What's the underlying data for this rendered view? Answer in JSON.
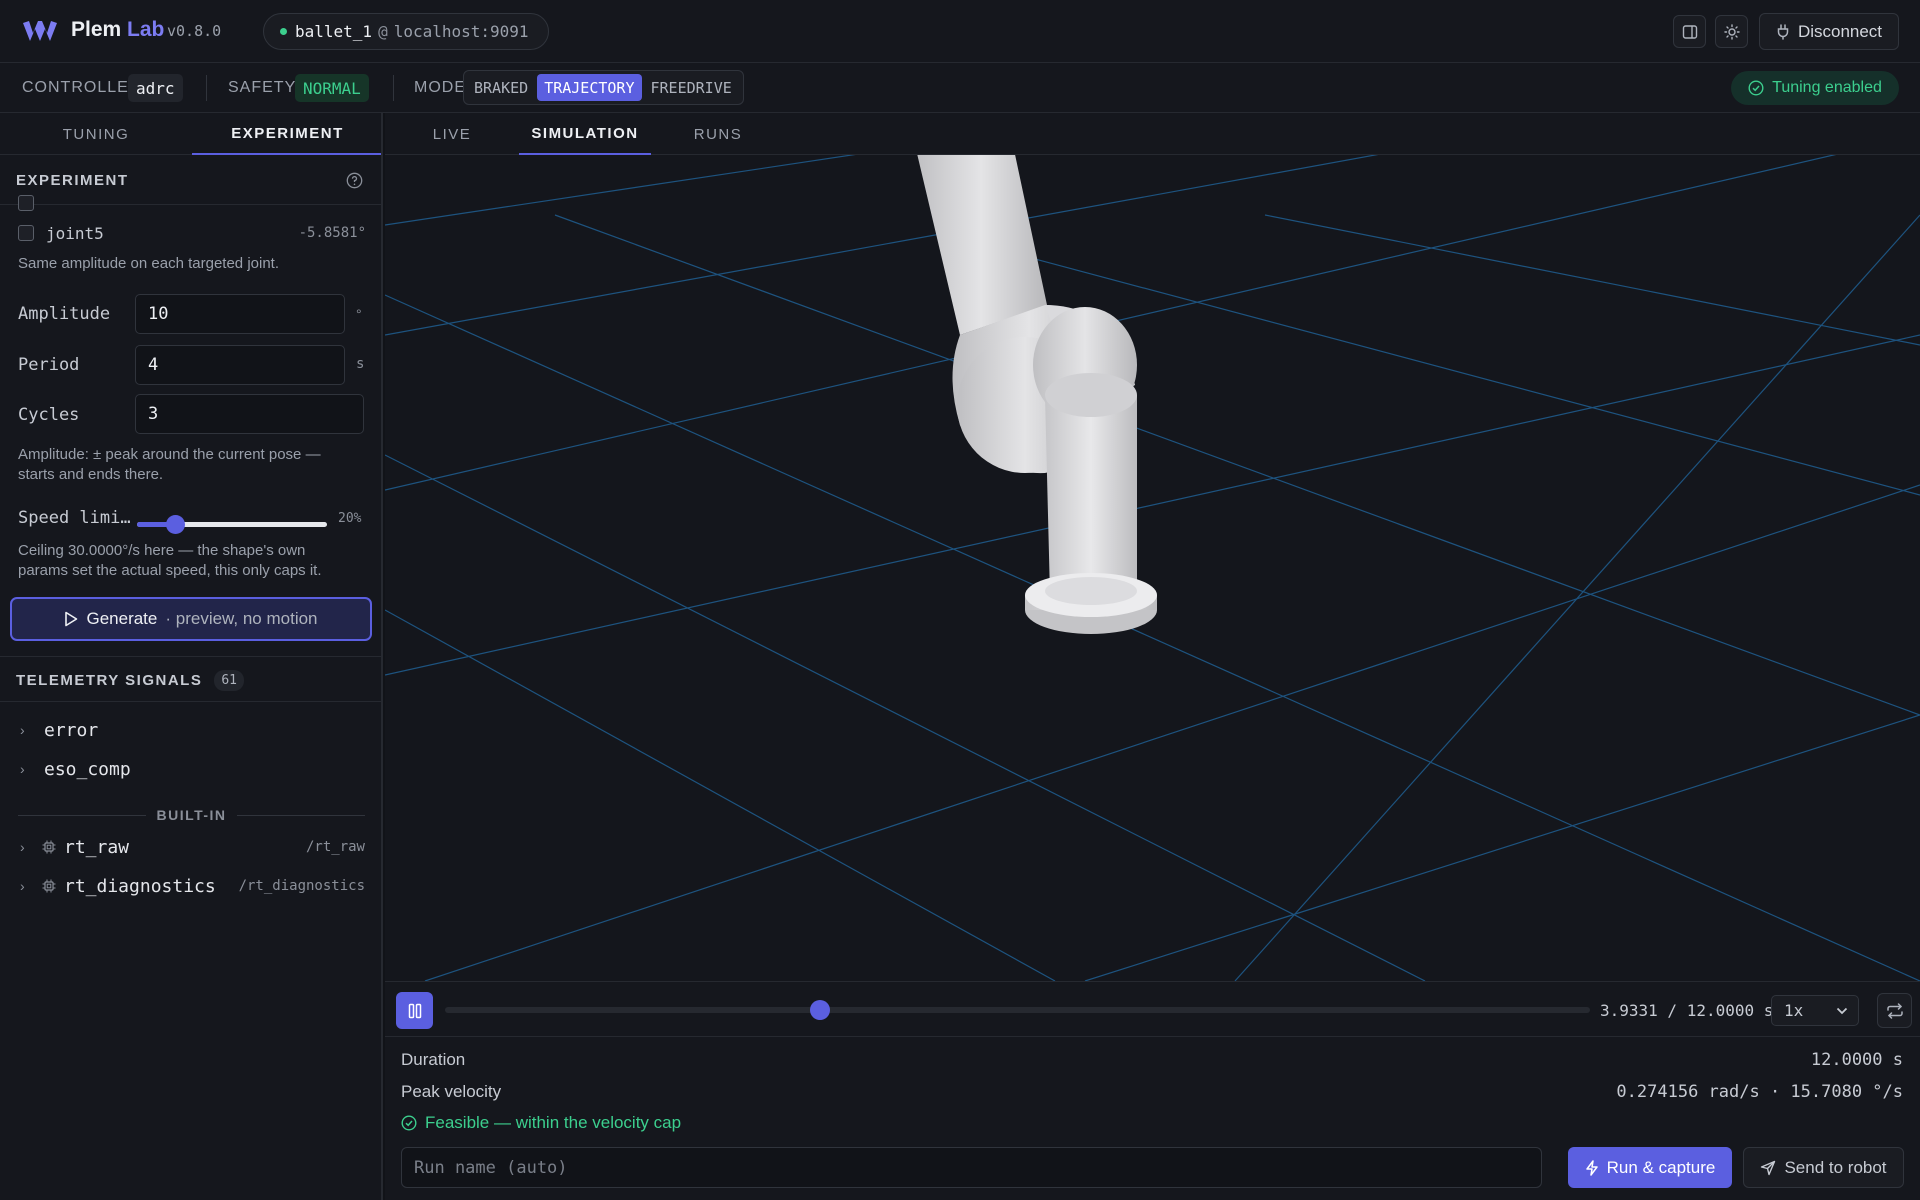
{
  "app": {
    "name_primary": "Plem",
    "name_accent": "Lab",
    "version": "v0.8.0",
    "connection": {
      "name": "ballet_1",
      "at": "@",
      "host": "localhost:9091"
    },
    "disconnect_label": "Disconnect"
  },
  "status_bar": {
    "controller_label": "CONTROLLER",
    "controller_value": "adrc",
    "safety_label": "SAFETY",
    "safety_value": "NORMAL",
    "mode_label": "MODE",
    "modes": [
      {
        "label": "BRAKED",
        "active": false
      },
      {
        "label": "TRAJECTORY",
        "active": true
      },
      {
        "label": "FREEDRIVE",
        "active": false
      }
    ],
    "tuning_badge": "Tuning enabled"
  },
  "left_panel": {
    "tabs": [
      {
        "label": "TUNING",
        "active": false
      },
      {
        "label": "EXPERIMENT",
        "active": true
      }
    ],
    "section_title": "EXPERIMENT",
    "joints": [
      {
        "name": "joint5",
        "value": "-5.8581°",
        "checked": false
      }
    ],
    "amplitude_note": "Same amplitude on each targeted joint.",
    "fields": {
      "amplitude": {
        "label": "Amplitude",
        "value": "10",
        "unit": "°"
      },
      "period": {
        "label": "Period",
        "value": "4",
        "unit": "s"
      },
      "cycles": {
        "label": "Cycles",
        "value": "3"
      }
    },
    "amplitude_help": "Amplitude: ± peak around the current pose — starts and ends there.",
    "speed_limit": {
      "label": "Speed limi…",
      "percent": 20,
      "display": "20%"
    },
    "speed_help": "Ceiling 30.0000°/s here — the shape's own params set the actual speed, this only caps it.",
    "generate": {
      "label": "Generate",
      "sub": "· preview, no motion"
    },
    "telemetry": {
      "title": "TELEMETRY SIGNALS",
      "count": "61",
      "custom": [
        {
          "name": "error"
        },
        {
          "name": "eso_comp"
        }
      ],
      "builtin_label": "BUILT-IN",
      "builtin": [
        {
          "name": "rt_raw",
          "path": "/rt_raw"
        },
        {
          "name": "rt_diagnostics",
          "path": "/rt_diagnostics"
        }
      ]
    }
  },
  "main": {
    "tabs": [
      {
        "label": "LIVE",
        "active": false
      },
      {
        "label": "SIMULATION",
        "active": true
      },
      {
        "label": "RUNS",
        "active": false
      }
    ],
    "playback": {
      "current": 3.9331,
      "total": 12.0,
      "readout": "3.9331 / 12.0000 s",
      "speed": "1x"
    },
    "summary": {
      "duration_label": "Duration",
      "duration_value": "12.0000 s",
      "peak_label": "Peak velocity",
      "peak_value": "0.274156 rad/s · 15.7080 °/s",
      "feasible": "Feasible — within the velocity cap"
    },
    "run_name_placeholder": "Run name (auto)",
    "run_capture_label": "Run & capture",
    "send_label": "Send to robot"
  },
  "colors": {
    "accent": "#5b5fe0",
    "success": "#3ccf8e",
    "background": "#111318"
  }
}
